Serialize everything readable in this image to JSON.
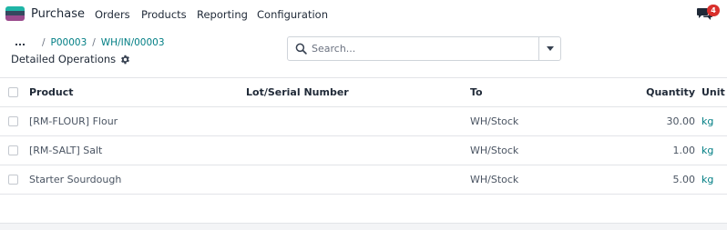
{
  "navbar": {
    "app_name": "Purchase",
    "menu": [
      "Orders",
      "Products",
      "Reporting",
      "Configuration"
    ],
    "chat_icon": "chat-bubbles-icon",
    "chat_badge": "4",
    "badge_color": "#d9302c"
  },
  "breadcrumb": {
    "ellipsis": "...",
    "items": [
      "P00003",
      "WH/IN/00003"
    ],
    "separator": "/"
  },
  "page_title": "Detailed Operations",
  "search": {
    "placeholder": "Search...",
    "value": ""
  },
  "table": {
    "columns": {
      "product": "Product",
      "lot": "Lot/Serial Number",
      "to": "To",
      "quantity": "Quantity",
      "unit": "Unit"
    },
    "rows": [
      {
        "product": "[RM-FLOUR] Flour",
        "lot": "",
        "to": "WH/Stock",
        "quantity": "30.00",
        "unit": "kg"
      },
      {
        "product": "[RM-SALT] Salt",
        "lot": "",
        "to": "WH/Stock",
        "quantity": "1.00",
        "unit": "kg"
      },
      {
        "product": "Starter Sourdough",
        "lot": "",
        "to": "WH/Stock",
        "quantity": "5.00",
        "unit": "kg"
      }
    ]
  },
  "colors": {
    "accent": "#017e84",
    "text": "#1f2937",
    "border": "#e2e4e8"
  }
}
